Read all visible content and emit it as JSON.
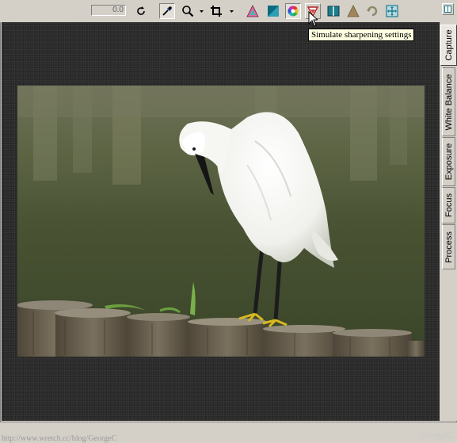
{
  "toolbar": {
    "angle_value": "0.0",
    "tools": [
      {
        "icon": "rotate-icon"
      },
      {
        "icon": "eyedropper-icon"
      },
      {
        "icon": "zoom-icon"
      },
      {
        "icon": "crop-icon"
      },
      {
        "icon": "highlight-warning-icon"
      },
      {
        "icon": "shadow-warning-icon"
      },
      {
        "icon": "color-wheel-icon"
      },
      {
        "icon": "simulate-sharpening-icon"
      },
      {
        "icon": "compare-icon"
      },
      {
        "icon": "triangle-icon"
      },
      {
        "icon": "undo-swirl-icon"
      },
      {
        "icon": "fit-screen-icon"
      }
    ],
    "tooltip": "Simulate sharpening settings"
  },
  "tabs": [
    {
      "label": "Capture",
      "selected": true
    },
    {
      "label": "White Balance",
      "selected": false
    },
    {
      "label": "Exposure",
      "selected": false
    },
    {
      "label": "Focus",
      "selected": false
    },
    {
      "label": "Process",
      "selected": false
    }
  ],
  "watermark": {
    "url": "http://www.wretch.cc/blog/GeorgeC",
    "signature": "GeorgeC"
  },
  "colors": {
    "canvas": "#2b2b2b",
    "panel": "#d4d0c8",
    "tooltip_bg": "#ffffe1"
  }
}
